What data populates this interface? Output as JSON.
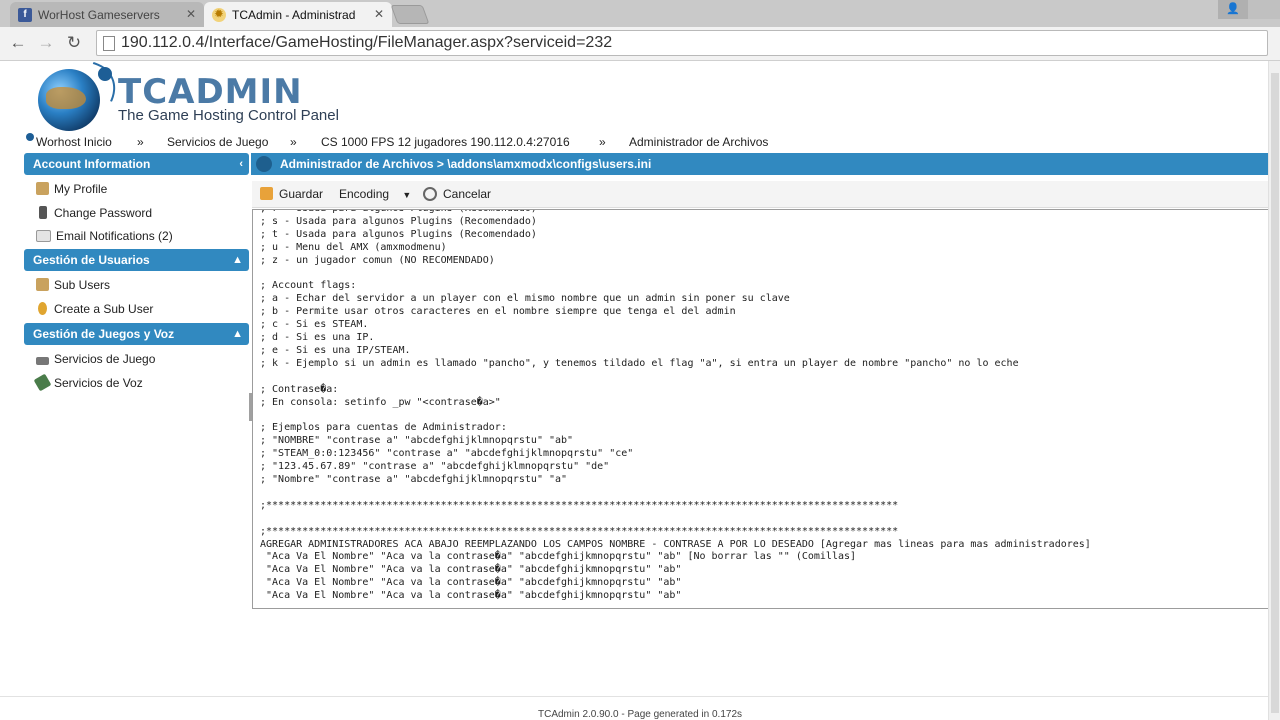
{
  "browser": {
    "tabs": [
      {
        "title": "WorHost Gameservers",
        "active": false,
        "favicon": "facebook-favicon",
        "color": "#3b5998"
      },
      {
        "title": "TCAdmin - Administrad",
        "active": true,
        "favicon": "sun-favicon",
        "color": "#f0c040"
      }
    ],
    "url": "190.112.0.4/Interface/GameHosting/FileManager.aspx?serviceid=232"
  },
  "header": {
    "logo_title": "TCADMIN",
    "logo_subtitle": "The Game Hosting Control Panel"
  },
  "breadcrumb": {
    "items": [
      "Worhost Inicio",
      "Servicios de Juego",
      "CS 1000 FPS 12 jugadores 190.112.0.4:27016",
      "Administrador de Archivos"
    ],
    "separator": "»"
  },
  "sidebar": {
    "sections": [
      {
        "title": "Account Information",
        "arrow": "‹",
        "items": [
          {
            "label": "My Profile",
            "icon": "user-icon"
          },
          {
            "label": "Change Password",
            "icon": "lock-icon"
          },
          {
            "label": "Email Notifications (2)",
            "icon": "envelope-icon"
          }
        ]
      },
      {
        "title": "Gestión de Usuarios",
        "arrow": "▲",
        "items": [
          {
            "label": "Sub Users",
            "icon": "users-icon"
          },
          {
            "label": "Create a Sub User",
            "icon": "add-user-icon"
          }
        ]
      },
      {
        "title": "Gestión de Juegos y Voz",
        "arrow": "▲",
        "items": [
          {
            "label": "Servicios de Juego",
            "icon": "game-icon"
          },
          {
            "label": "Servicios de Voz",
            "icon": "voice-icon"
          }
        ]
      }
    ]
  },
  "main": {
    "header": "Administrador de Archivos > \\addons\\amxmodx\\configs\\users.ini",
    "toolbar": {
      "save_label": "Guardar",
      "encoding_label": "Encoding",
      "cancel_label": "Cancelar"
    },
    "file_lines": [
      "; r - Usada para algunos Plugins (Recomendado)",
      "; s - Usada para algunos Plugins (Recomendado)",
      "; t - Usada para algunos Plugins (Recomendado)",
      "; u - Menu del AMX (amxmodmenu)",
      "; z - un jugador comun (NO RECOMENDADO)",
      "",
      "; Account flags:",
      "; a - Echar del servidor a un player con el mismo nombre que un admin sin poner su clave",
      "; b - Permite usar otros caracteres en el nombre siempre que tenga el del admin",
      "; c - Si es STEAM.",
      "; d - Si es una IP.",
      "; e - Si es una IP/STEAM.",
      "; k - Ejemplo si un admin es llamado \"pancho\", y tenemos tildado el flag \"a\", si entra un player de nombre \"pancho\" no lo eche",
      "",
      "; Contrase�a:",
      "; En consola: setinfo _pw \"<contrase�a>\"",
      "",
      "; Ejemplos para cuentas de Administrador:",
      "; \"NOMBRE\" \"contrase a\" \"abcdefghijklmnopqrstu\" \"ab\"",
      "; \"STEAM_0:0:123456\" \"contrase a\" \"abcdefghijklmnopqrstu\" \"ce\"",
      "; \"123.45.67.89\" \"contrase a\" \"abcdefghijklmnopqrstu\" \"de\"",
      "; \"Nombre\" \"contrase a\" \"abcdefghijklmnopqrstu\" \"a\"",
      "",
      ";*********************************************************************************************************",
      "",
      ";*********************************************************************************************************",
      "AGREGAR ADMINISTRADORES ACA ABAJO REEMPLAZANDO LOS CAMPOS NOMBRE - CONTRASE A POR LO DESEADO [Agregar mas lineas para mas administradores]",
      " \"Aca Va El Nombre\" \"Aca va la contrase�a\" \"abcdefghijkmnopqrstu\" \"ab\" [No borrar las \"\" (Comillas]",
      " \"Aca Va El Nombre\" \"Aca va la contrase�a\" \"abcdefghijkmnopqrstu\" \"ab\"",
      " \"Aca Va El Nombre\" \"Aca va la contrase�a\" \"abcdefghijkmnopqrstu\" \"ab\"",
      " \"Aca Va El Nombre\" \"Aca va la contrase�a\" \"abcdefghijkmnopqrstu\" \"ab\""
    ]
  },
  "footer": {
    "text": "TCAdmin 2.0.90.0 - Page generated in 0.172s"
  },
  "colors": {
    "accent": "#3189c0",
    "panel_text": "#ffffff"
  }
}
